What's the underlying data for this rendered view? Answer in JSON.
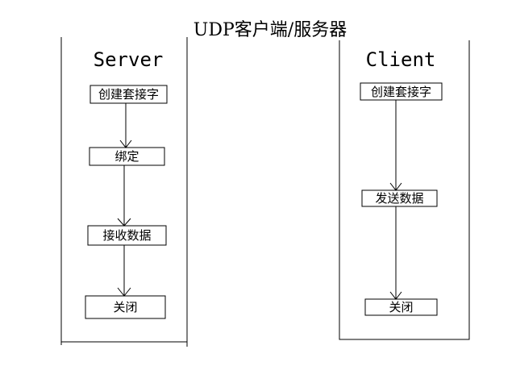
{
  "title": "UDP客户端/服务器",
  "server": {
    "title": "Server",
    "steps": [
      "创建套接字",
      "绑定",
      "接收数据",
      "关闭"
    ]
  },
  "client": {
    "title": "Client",
    "steps": [
      "创建套接字",
      "发送数据",
      "关闭"
    ]
  }
}
